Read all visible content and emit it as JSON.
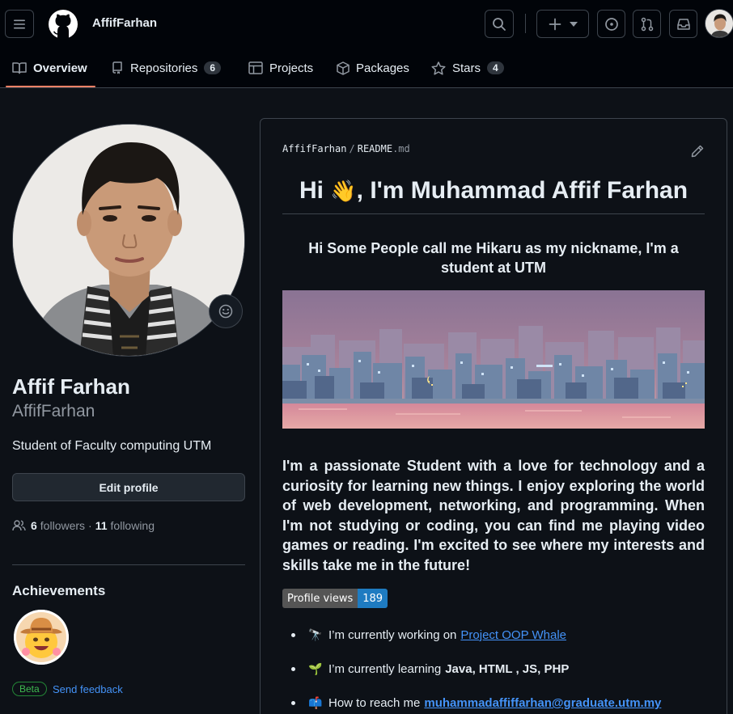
{
  "header": {
    "username": "AffifFarhan"
  },
  "tabs": [
    {
      "label": "Overview"
    },
    {
      "label": "Repositories",
      "count": "6"
    },
    {
      "label": "Projects"
    },
    {
      "label": "Packages"
    },
    {
      "label": "Stars",
      "count": "4"
    }
  ],
  "profile": {
    "fullname": "Affif Farhan",
    "login": "AffifFarhan",
    "bio": "Student of Faculty computing UTM",
    "edit_label": "Edit profile",
    "followers_count": "6",
    "followers_label": "followers",
    "separator": "·",
    "following_count": "11",
    "following_label": "following",
    "achievements_title": "Achievements",
    "beta_label": "Beta",
    "feedback_label": "Send feedback"
  },
  "readme": {
    "path_user": "AffifFarhan",
    "path_sep": "/",
    "path_file": "README",
    "path_ext": ".md",
    "h1_pre": "Hi ",
    "h1_emoji": "👋",
    "h1_post": ", I'm Muhammad Affif Farhan",
    "h3": "Hi Some People call me Hikaru as my nickname, I'm a student at UTM",
    "paragraph": "I'm a passionate Student with a love for technology and a curiosity for learning new things. I enjoy exploring the world of web development, networking, and programming. When I'm not studying or coding, you can find me playing video games or reading. I'm excited to see where my interests and skills take me in the future!",
    "views_label": "Profile views",
    "views_count": "189",
    "items": [
      {
        "emoji": "🔭",
        "text": "I’m currently working on",
        "link": "Project OOP Whale"
      },
      {
        "emoji": "🌱",
        "text": "I’m currently learning",
        "bold": "Java, HTML , JS, PHP"
      },
      {
        "emoji": "📫",
        "text": "How to reach me",
        "link": "muhammadaffiffarhan@graduate.utm.my"
      }
    ]
  },
  "colors": {
    "bg": "#0d1117",
    "header_bg": "#010409",
    "border": "#3d444d",
    "accent_tab": "#f78166",
    "link": "#4493f8",
    "views_badge": "#1e7bc1"
  }
}
